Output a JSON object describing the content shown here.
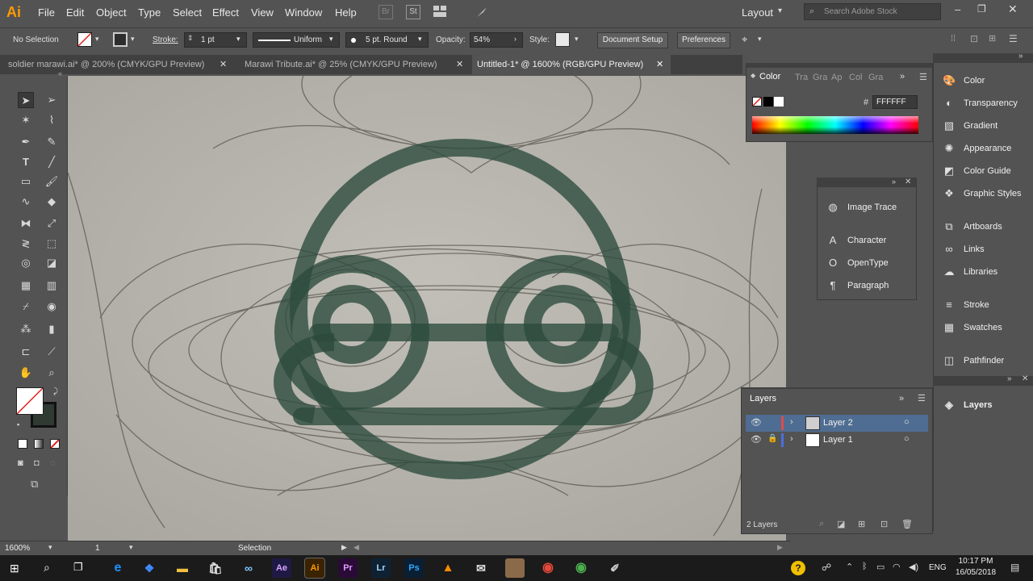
{
  "app": {
    "logo": "Ai"
  },
  "menu": [
    "File",
    "Edit",
    "Object",
    "Type",
    "Select",
    "Effect",
    "View",
    "Window",
    "Help"
  ],
  "menubar_right": {
    "br_label": "Br",
    "st_label": "St",
    "workspace": "Layout",
    "search_placeholder": "Search Adobe Stock"
  },
  "control": {
    "selection": "No Selection",
    "stroke_label": "Stroke:",
    "stroke_value": "1 pt",
    "profile": "Uniform",
    "brush": "5 pt. Round",
    "opacity_label": "Opacity:",
    "opacity_value": "54%",
    "style_label": "Style:",
    "document_setup": "Document Setup",
    "preferences": "Preferences"
  },
  "tabs": [
    {
      "label": "soldier marawi.ai* @ 200% (CMYK/GPU Preview)",
      "active": false
    },
    {
      "label": "Marawi Tribute.ai* @ 25% (CMYK/GPU Preview)",
      "active": false
    },
    {
      "label": "Untitled-1* @ 1600% (RGB/GPU Preview)",
      "active": true
    }
  ],
  "color_panel": {
    "tabs": [
      "Color",
      "Tra",
      "Gra",
      "Ap",
      "Col",
      "Gra"
    ],
    "hex_prefix": "#",
    "hex": "FFFFFF"
  },
  "float_panel": {
    "items": [
      {
        "label": "Image Trace",
        "icon": "image-trace-icon"
      },
      {
        "label": "Character",
        "icon": "character-icon"
      },
      {
        "label": "OpenType",
        "icon": "opentype-icon"
      },
      {
        "label": "Paragraph",
        "icon": "paragraph-icon"
      }
    ]
  },
  "dock": {
    "items": [
      {
        "label": "Color",
        "icon": "color-icon"
      },
      {
        "label": "Transparency",
        "icon": "transparency-icon"
      },
      {
        "label": "Gradient",
        "icon": "gradient-icon"
      },
      {
        "label": "Appearance",
        "icon": "appearance-icon"
      },
      {
        "label": "Color Guide",
        "icon": "color-guide-icon"
      },
      {
        "label": "Graphic Styles",
        "icon": "graphic-styles-icon"
      },
      {
        "label": "Artboards",
        "icon": "artboards-icon"
      },
      {
        "label": "Links",
        "icon": "links-icon"
      },
      {
        "label": "Libraries",
        "icon": "libraries-icon"
      },
      {
        "label": "Stroke",
        "icon": "stroke-icon"
      },
      {
        "label": "Swatches",
        "icon": "swatches-icon"
      },
      {
        "label": "Pathfinder",
        "icon": "pathfinder-icon"
      },
      {
        "label": "Layers",
        "icon": "layers-icon"
      }
    ]
  },
  "layers_panel": {
    "title": "Layers",
    "layers": [
      {
        "name": "Layer 2",
        "color": "#e04b4b",
        "selected": true
      },
      {
        "name": "Layer 1",
        "color": "#4b6fe0",
        "selected": false
      }
    ],
    "count": "2 Layers"
  },
  "status": {
    "zoom": "1600%",
    "artboard": "1",
    "tool": "Selection"
  },
  "taskbar": {
    "lang": "ENG",
    "time": "10:17 PM",
    "date": "16/05/2018"
  },
  "taskbar_apps": [
    {
      "label": "Ae",
      "bg": "#1f1a45",
      "fg": "#d8a6ff"
    },
    {
      "label": "Ai",
      "bg": "#3a2300",
      "fg": "#ff9a00"
    },
    {
      "label": "Pr",
      "bg": "#2a0a36",
      "fg": "#e09cff"
    },
    {
      "label": "Lr",
      "bg": "#0e2233",
      "fg": "#a8d8ff"
    },
    {
      "label": "Ps",
      "bg": "#0a1f33",
      "fg": "#31a8ff"
    }
  ],
  "colors": {
    "accent_artwork": "#2c4a3c",
    "selected_layer": "#4f6d92"
  }
}
